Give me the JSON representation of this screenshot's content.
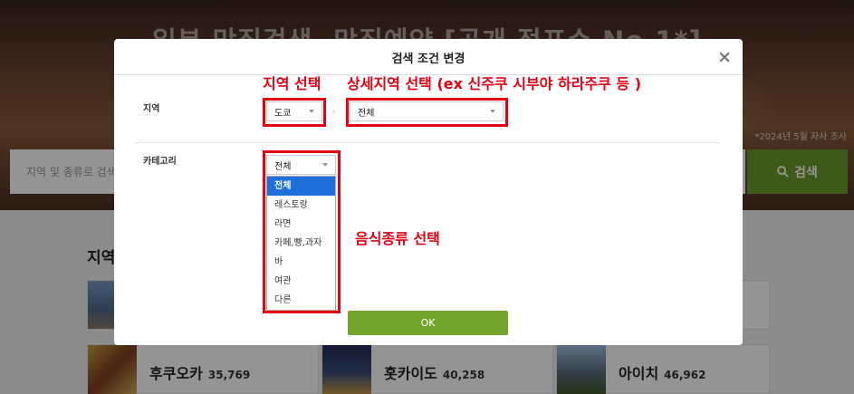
{
  "hero": {
    "title": "일본 맛집검색, 맛집예약 [공개 점포수 No.1*]",
    "note": "*2024년 5월 자사 조사",
    "search_placeholder": "지역 및 종류로 검색",
    "search_button": "검색"
  },
  "section": {
    "title": "지역",
    "regions": [
      {
        "name": "후쿠오카",
        "count": "35,769"
      },
      {
        "name": "홋카이도",
        "count": "40,258"
      },
      {
        "name": "아이치",
        "count": "46,962"
      }
    ]
  },
  "modal": {
    "title": "검색 조건 변경",
    "close": "×",
    "region_label": "지역",
    "region_select": "도쿄",
    "subregion_select": "전체",
    "category_label": "카테고리",
    "category_select": "전체",
    "category_options": [
      "전체",
      "레스토랑",
      "라면",
      "카페,빵,과자",
      "바",
      "여관",
      "다른"
    ],
    "selected_option_index": 0,
    "ok_button": "OK"
  },
  "annotations": {
    "region_select": "지역 선택",
    "subregion_select": "상세지역 선택 (ex 신주쿠 시부야 하라주쿠 등 )",
    "category_select": "음식종류 선택"
  },
  "colors": {
    "accent_green": "#74a52a",
    "annotation_red": "#e60012",
    "selected_blue": "#1e6fd9"
  }
}
